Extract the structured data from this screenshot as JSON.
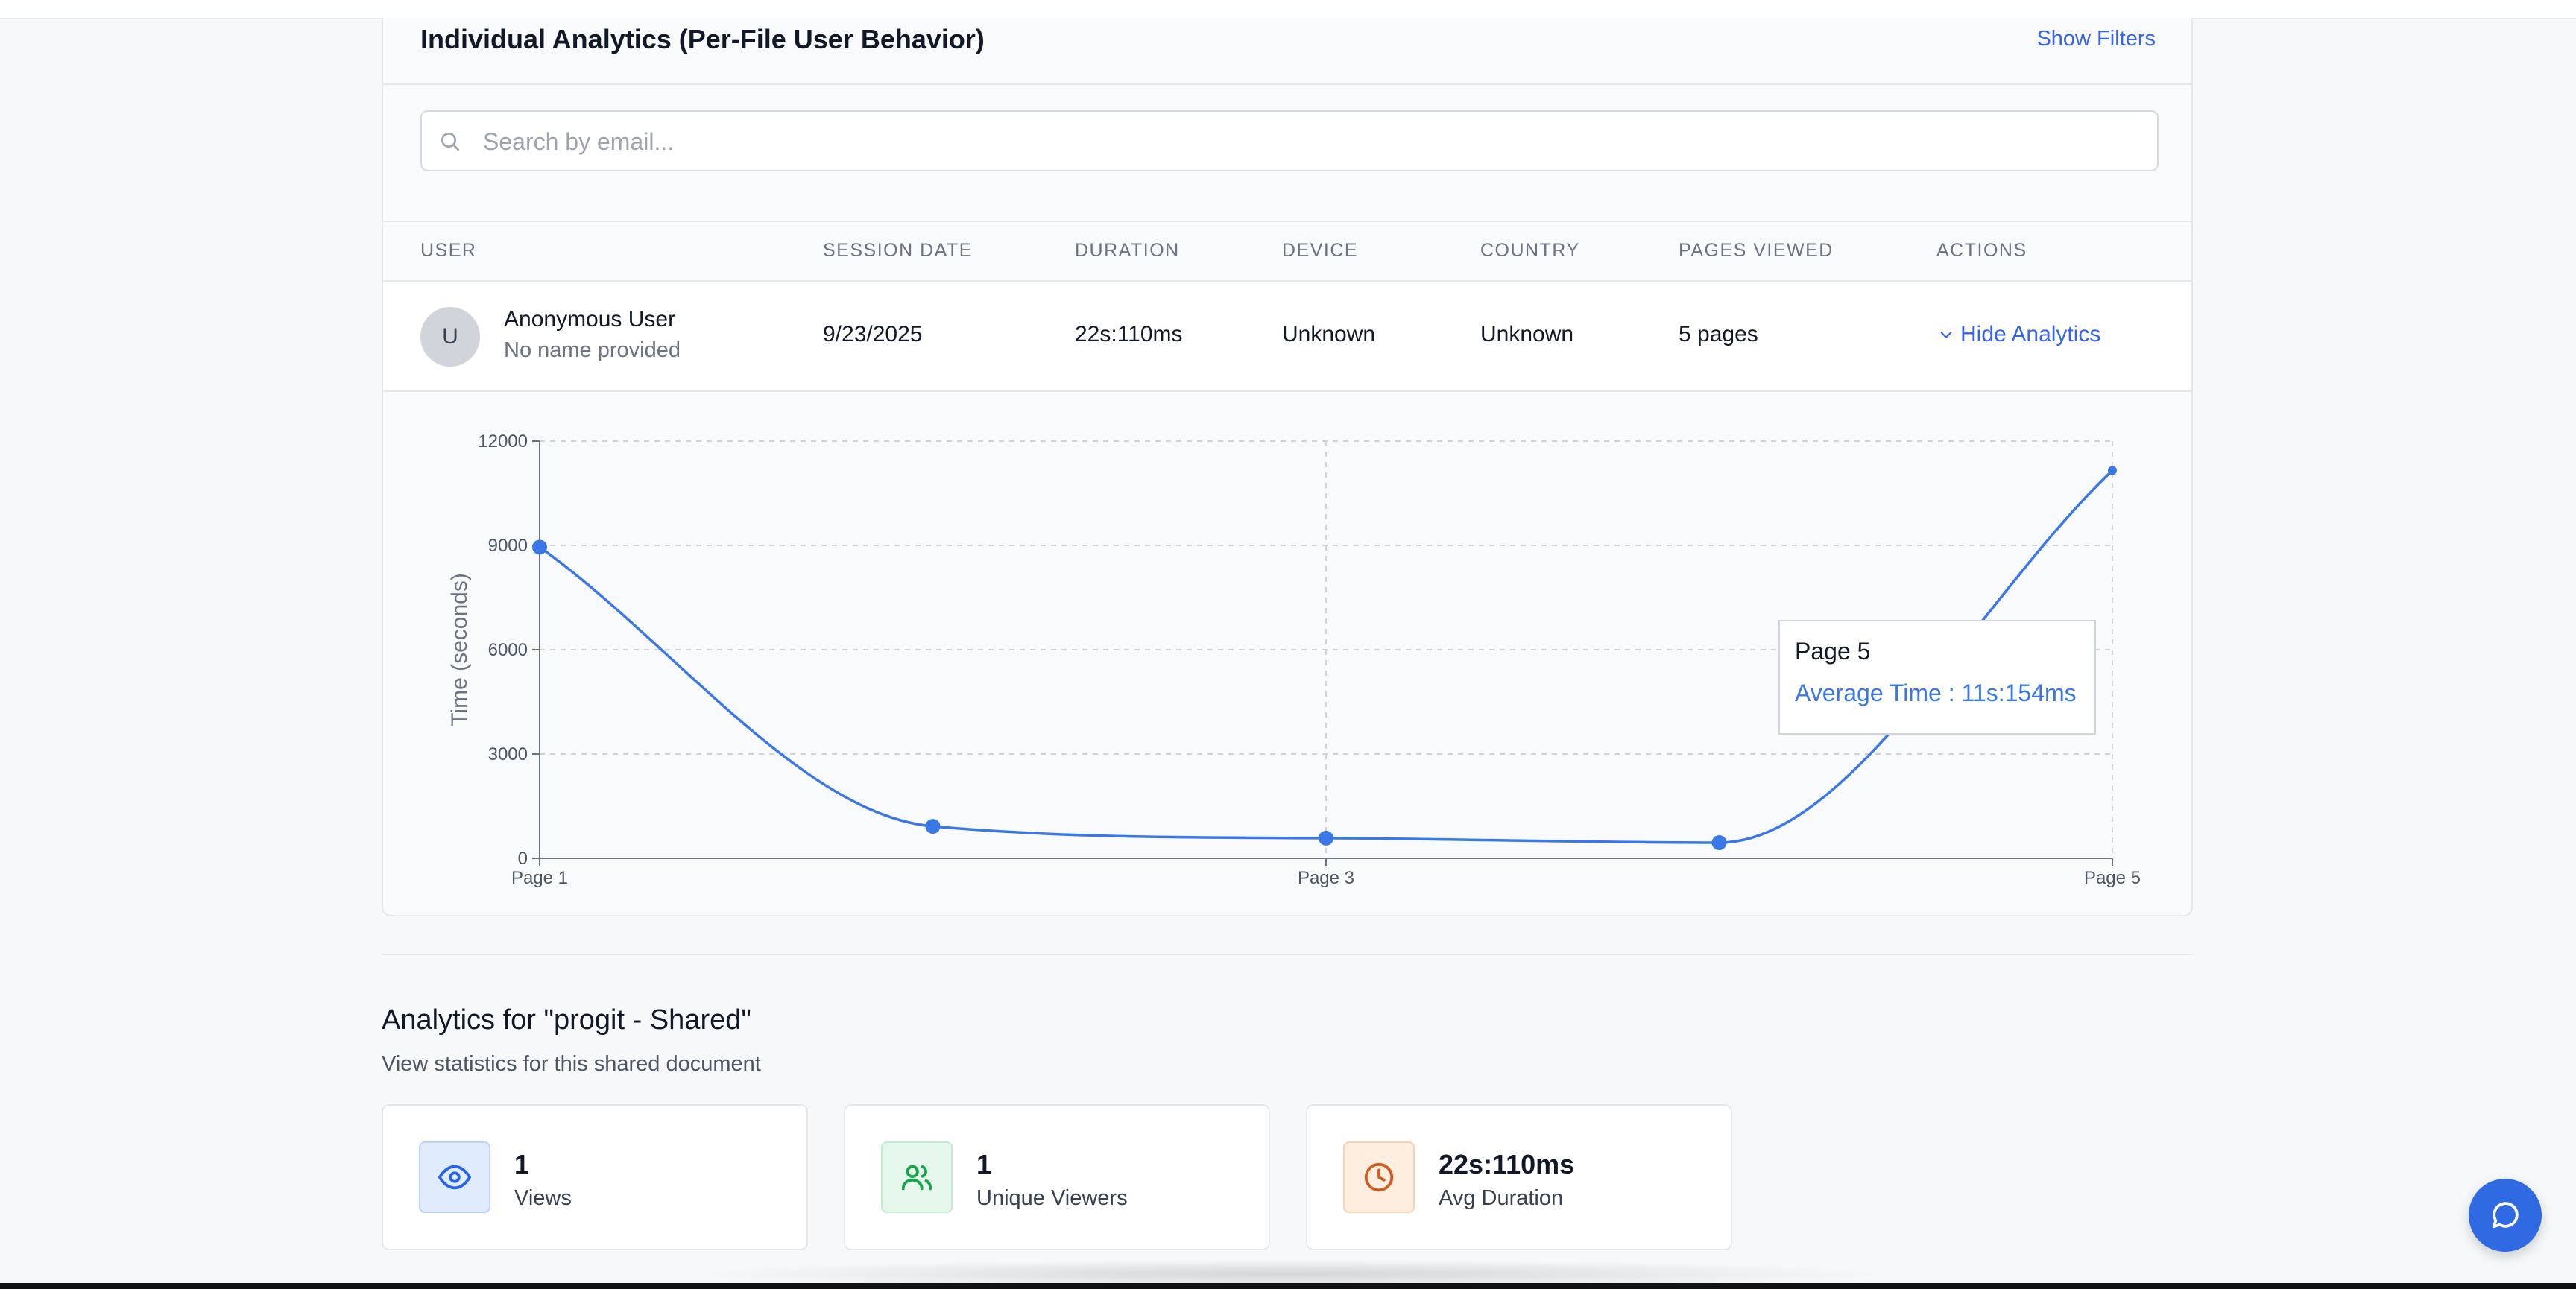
{
  "individual": {
    "title": "Individual Analytics (Per-File User Behavior)",
    "show_filters": "Show Filters",
    "search": {
      "placeholder": "Search by email...",
      "value": ""
    },
    "columns": [
      "USER",
      "SESSION DATE",
      "DURATION",
      "DEVICE",
      "COUNTRY",
      "PAGES VIEWED",
      "ACTIONS"
    ],
    "rows": [
      {
        "avatar": "U",
        "name": "Anonymous User",
        "subtitle": "No name provided",
        "session_date": "9/23/2025",
        "duration": "22s:110ms",
        "device": "Unknown",
        "country": "Unknown",
        "pages_viewed": "5 pages",
        "action": "Hide Analytics"
      }
    ]
  },
  "chart_data": {
    "type": "line",
    "ylabel": "Time (seconds)",
    "xlabel": "",
    "x": [
      1,
      2,
      3,
      4,
      5
    ],
    "x_tick_labels": [
      "Page 1",
      "Page 3",
      "Page 5"
    ],
    "x_tick_positions": [
      1,
      3,
      5
    ],
    "y_ticks": [
      0,
      3000,
      6000,
      9000,
      12000
    ],
    "ylim": [
      0,
      12000
    ],
    "series": [
      {
        "values": [
          8950,
          920,
          580,
          450,
          11154
        ],
        "color": "#3b78e7"
      }
    ],
    "grid": true,
    "tooltip": {
      "label": "Page 5",
      "value": "Average Time : 11s:154ms"
    }
  },
  "summary": {
    "title": "Analytics for \"progit - Shared\"",
    "subtitle": "View statistics for this shared document",
    "stats": [
      {
        "value": "1",
        "label": "Views",
        "icon": "eye-icon",
        "color": "#2563eb",
        "bg": "#e0ebfd"
      },
      {
        "value": "1",
        "label": "Unique Viewers",
        "icon": "users-icon",
        "color": "#16a34a",
        "bg": "#e4f7ea"
      },
      {
        "value": "22s:110ms",
        "label": "Avg Duration",
        "icon": "clock-icon",
        "color": "#d35a1f",
        "bg": "#fdeee0"
      }
    ]
  },
  "chat": {
    "icon": "chat-icon"
  }
}
